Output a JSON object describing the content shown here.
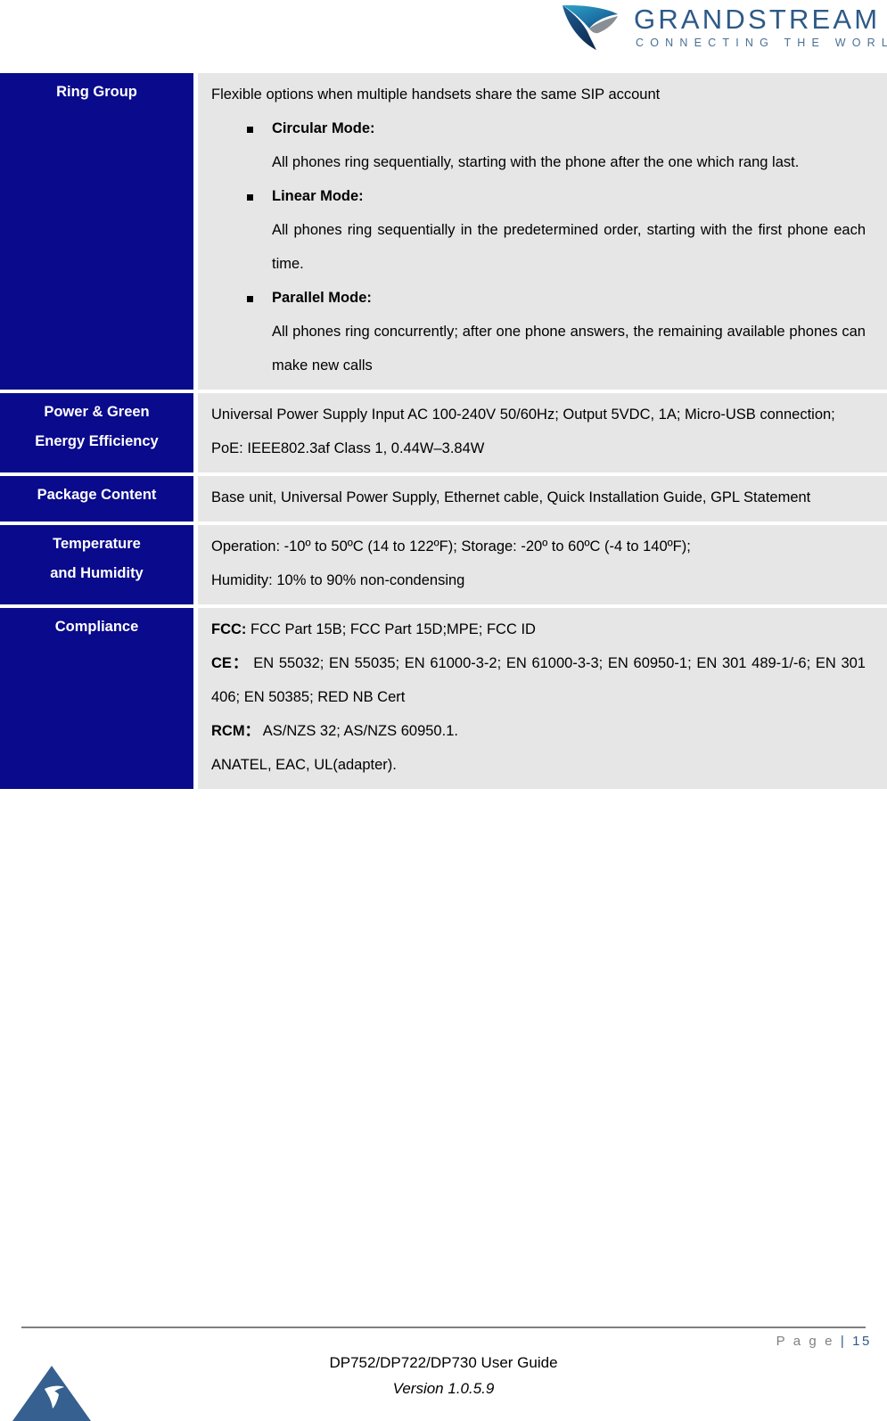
{
  "header": {
    "logo_name": "grandstream-logo",
    "logo_wordmark": "GRANDSTREAM",
    "logo_tagline": "CONNECTING THE WORLD"
  },
  "table": {
    "rows": [
      {
        "label": "Ring Group",
        "intro": "Flexible options when multiple handsets share the same SIP account",
        "modes": [
          {
            "title": "Circular Mode:",
            "description": "All phones ring sequentially, starting with the phone after the one which rang last."
          },
          {
            "title": "Linear Mode:",
            "description": "All phones ring sequentially in the predetermined order, starting with the first phone each time."
          },
          {
            "title": "Parallel Mode:",
            "description": "All phones ring concurrently; after one phone answers, the remaining available phones can make new calls"
          }
        ]
      },
      {
        "label_line1": "Power & Green",
        "label_line2": "Energy Efficiency",
        "lines": [
          "Universal Power Supply Input AC 100-240V 50/60Hz; Output 5VDC, 1A; Micro-USB connection;",
          "PoE: IEEE802.3af Class 1, 0.44W–3.84W"
        ]
      },
      {
        "label": "Package Content",
        "lines": [
          "Base unit, Universal Power Supply, Ethernet cable, Quick Installation Guide, GPL Statement"
        ]
      },
      {
        "label_line1": "Temperature",
        "label_line2": "and Humidity",
        "lines": [
          "Operation: -10º to 50ºC (14 to 122ºF); Storage: -20º to 60ºC (-4 to 140ºF);",
          "Humidity: 10% to 90% non-condensing"
        ]
      },
      {
        "label": "Compliance",
        "compliance": {
          "fcc_label": "FCC:",
          "fcc_value": " FCC Part 15B; FCC Part 15D;MPE; FCC ID",
          "ce_label": "CE：",
          "ce_value": " EN 55032; EN 55035; EN 61000-3-2; EN 61000-3-3; EN 60950-1; EN 301 489-1/-6; EN 301 406; EN 50385; RED NB Cert",
          "rcm_label": "RCM：",
          "rcm_value": " AS/NZS 32; AS/NZS 60950.1.",
          "extra": "ANATEL, EAC, UL(adapter)."
        }
      }
    ]
  },
  "footer": {
    "page_word": "P a g e ",
    "page_separator": "| ",
    "page_number": "15",
    "document_title": "DP752/DP722/DP730 User Guide",
    "version": "Version 1.0.5.9",
    "mark_name": "grandstream-triangle-mark"
  },
  "colors": {
    "label_blue": "#0a0a8c",
    "value_gray": "#e6e6e6",
    "accent_blue": "#2e5a87",
    "rule_gray": "#808080"
  }
}
